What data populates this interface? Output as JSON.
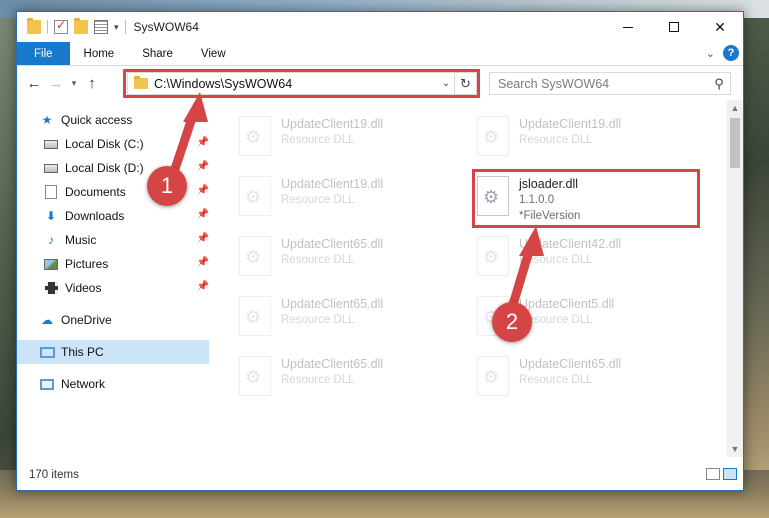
{
  "window": {
    "title": "SysWOW64"
  },
  "ribbon": {
    "tabs": [
      "File",
      "Home",
      "Share",
      "View"
    ],
    "help": "?"
  },
  "address": {
    "path": "C:\\Windows\\SysWOW64",
    "search_placeholder": "Search SysWOW64"
  },
  "nav": {
    "quick_access": "Quick access",
    "items": [
      {
        "label": "Local Disk (C:)",
        "icon": "disk-icon"
      },
      {
        "label": "Local Disk (D:)",
        "icon": "disk-icon"
      },
      {
        "label": "Documents",
        "icon": "documents-icon"
      },
      {
        "label": "Downloads",
        "icon": "downloads-icon"
      },
      {
        "label": "Music",
        "icon": "music-icon"
      },
      {
        "label": "Pictures",
        "icon": "pictures-icon"
      },
      {
        "label": "Videos",
        "icon": "videos-icon"
      }
    ],
    "onedrive": "OneDrive",
    "this_pc": "This PC",
    "network": "Network"
  },
  "files": [
    {
      "name": "UpdateClient19.dll",
      "sub": "Resource DLL"
    },
    {
      "name": "UpdateClient19.dll",
      "sub": "Resource DLL"
    },
    {
      "name": "UpdateClient19.dll",
      "sub": "Resource DLL"
    },
    {
      "name": "jsloader.dll",
      "version": "1.1.0.0",
      "sub": "*FileVersion"
    },
    {
      "name": "UpdateClient65.dll",
      "sub": "Resource DLL"
    },
    {
      "name": "UpdateClient42.dll",
      "sub": "Resource DLL"
    },
    {
      "name": "UpdateClient65.dll",
      "sub": "Resource DLL"
    },
    {
      "name": "UpdateClient5.dll",
      "sub": "Resource DLL"
    },
    {
      "name": "UpdateClient65.dll",
      "sub": "Resource DLL"
    },
    {
      "name": "UpdateClient65.dll",
      "sub": "Resource DLL"
    }
  ],
  "status": {
    "count": "170 items"
  },
  "annotations": {
    "step1": "1",
    "step2": "2"
  },
  "colors": {
    "accent": "#1979ca",
    "highlight": "#d64545",
    "selected": "#cce4f7"
  }
}
